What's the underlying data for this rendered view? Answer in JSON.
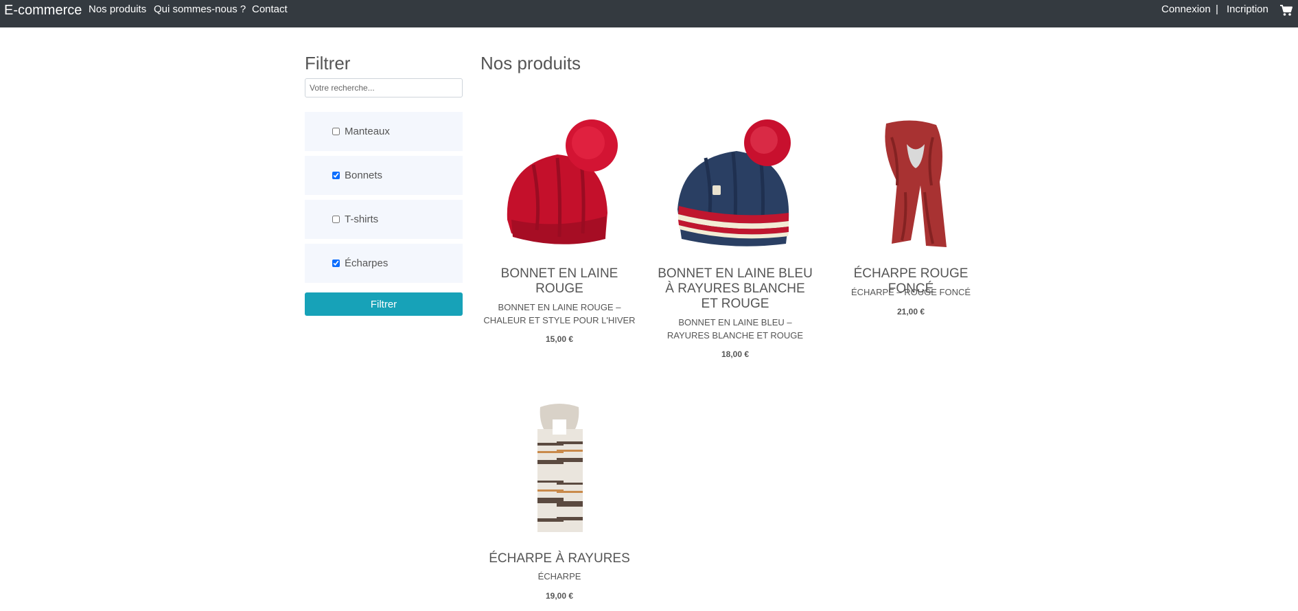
{
  "navbar": {
    "brand": "E-commerce",
    "links": [
      "Nos produits",
      "Qui sommes-nous ?",
      "Contact"
    ],
    "login": "Connexion",
    "separator": "|",
    "register": "Incription",
    "cart_icon": "cart-icon"
  },
  "sidebar": {
    "title": "Filtrer",
    "search_placeholder": "Votre recherche...",
    "categories": [
      {
        "label": "Manteaux",
        "checked": false
      },
      {
        "label": "Bonnets",
        "checked": true
      },
      {
        "label": "T-shirts",
        "checked": false
      },
      {
        "label": "Écharpes",
        "checked": true
      }
    ],
    "filter_button": "Filtrer"
  },
  "main": {
    "title": "Nos produits",
    "products": [
      {
        "name": "BONNET EN LAINE ROUGE",
        "description": "BONNET EN LAINE ROUGE – CHALEUR ET STYLE POUR L'HIVER",
        "price": "15,00 €"
      },
      {
        "name": "BONNET EN LAINE BLEU À RAYURES BLANCHE ET ROUGE",
        "description": "BONNET EN LAINE BLEU – RAYURES BLANCHE ET ROUGE",
        "price": "18,00 €"
      },
      {
        "name": "ÉCHARPE ROUGE FONCÉ",
        "description": "ÉCHARPE – ROUGE FONCÉ",
        "price": "21,00 €"
      },
      {
        "name": "ÉCHARPE À RAYURES",
        "description": "ÉCHARPE",
        "price": "19,00 €"
      }
    ]
  },
  "colors": {
    "navbar_bg": "#343a40",
    "filter_button": "#17a2b8",
    "category_bg": "#f4f7fd"
  }
}
